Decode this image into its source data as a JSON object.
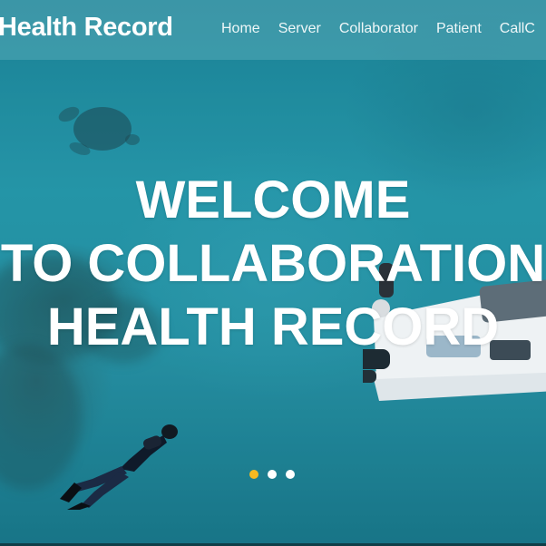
{
  "header": {
    "brand": "Health Record",
    "nav": [
      {
        "label": "Home"
      },
      {
        "label": "Server"
      },
      {
        "label": "Collaborator"
      },
      {
        "label": "Patient"
      },
      {
        "label": "CallC"
      }
    ]
  },
  "hero": {
    "lines": [
      "WELCOME",
      "TO COLLABORATION",
      "HEALTH RECORD"
    ]
  },
  "carousel": {
    "slide_count": 3,
    "active_index": 0,
    "active_color": "#f5b921",
    "inactive_color": "#ffffff"
  },
  "colors": {
    "water": "#2a9cb0",
    "nav_overlay": "rgba(120,190,200,0.35)"
  }
}
